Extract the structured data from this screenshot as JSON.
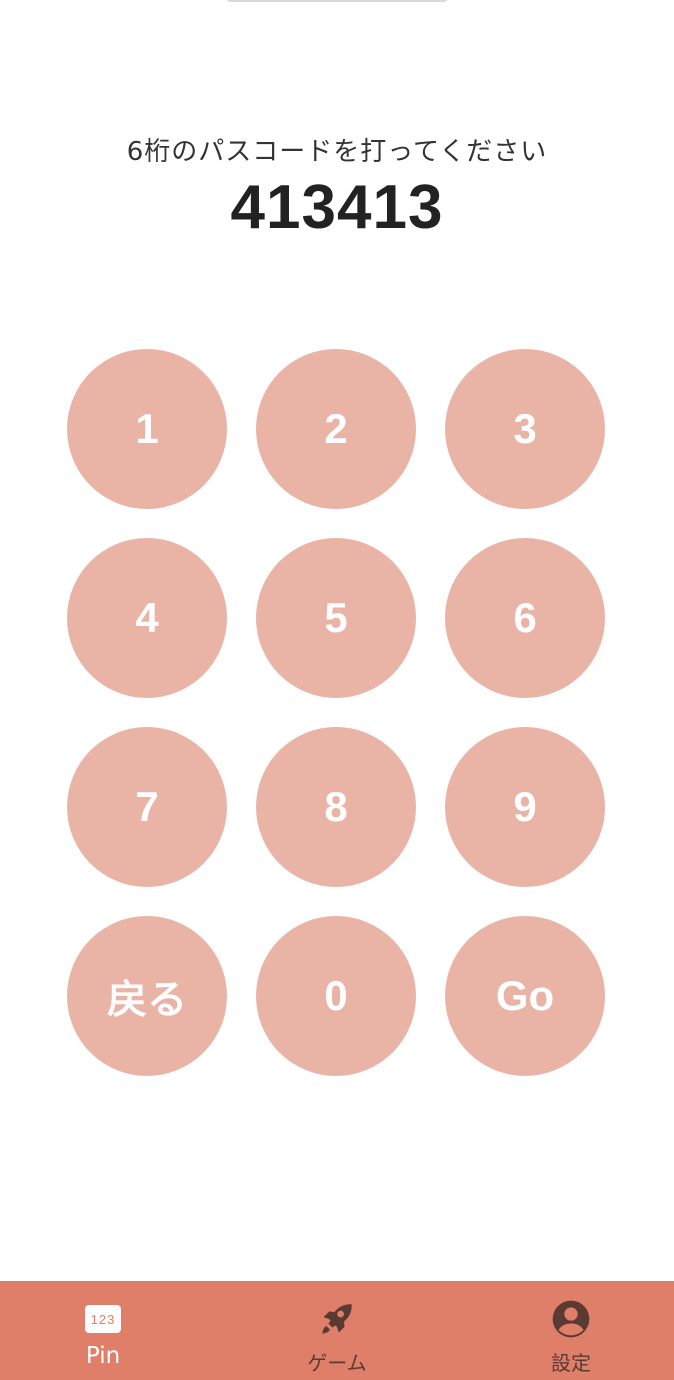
{
  "header": {
    "prompt": "6桁のパスコードを打ってください",
    "code": "413413"
  },
  "keypad": {
    "keys": [
      "1",
      "2",
      "3",
      "4",
      "5",
      "6",
      "7",
      "8",
      "9",
      "戻る",
      "0",
      "Go"
    ]
  },
  "tabbar": {
    "tabs": [
      {
        "label": "Pin",
        "icon": "pin-numbers-icon",
        "icon_text": "123",
        "active": true
      },
      {
        "label": "ゲーム",
        "icon": "rocket-icon",
        "active": false
      },
      {
        "label": "設定",
        "icon": "account-circle-icon",
        "active": false
      }
    ]
  },
  "colors": {
    "key_bg": "#e9b3a6",
    "tabbar_bg": "#e07f69",
    "tab_icon": "#5a3a33"
  }
}
